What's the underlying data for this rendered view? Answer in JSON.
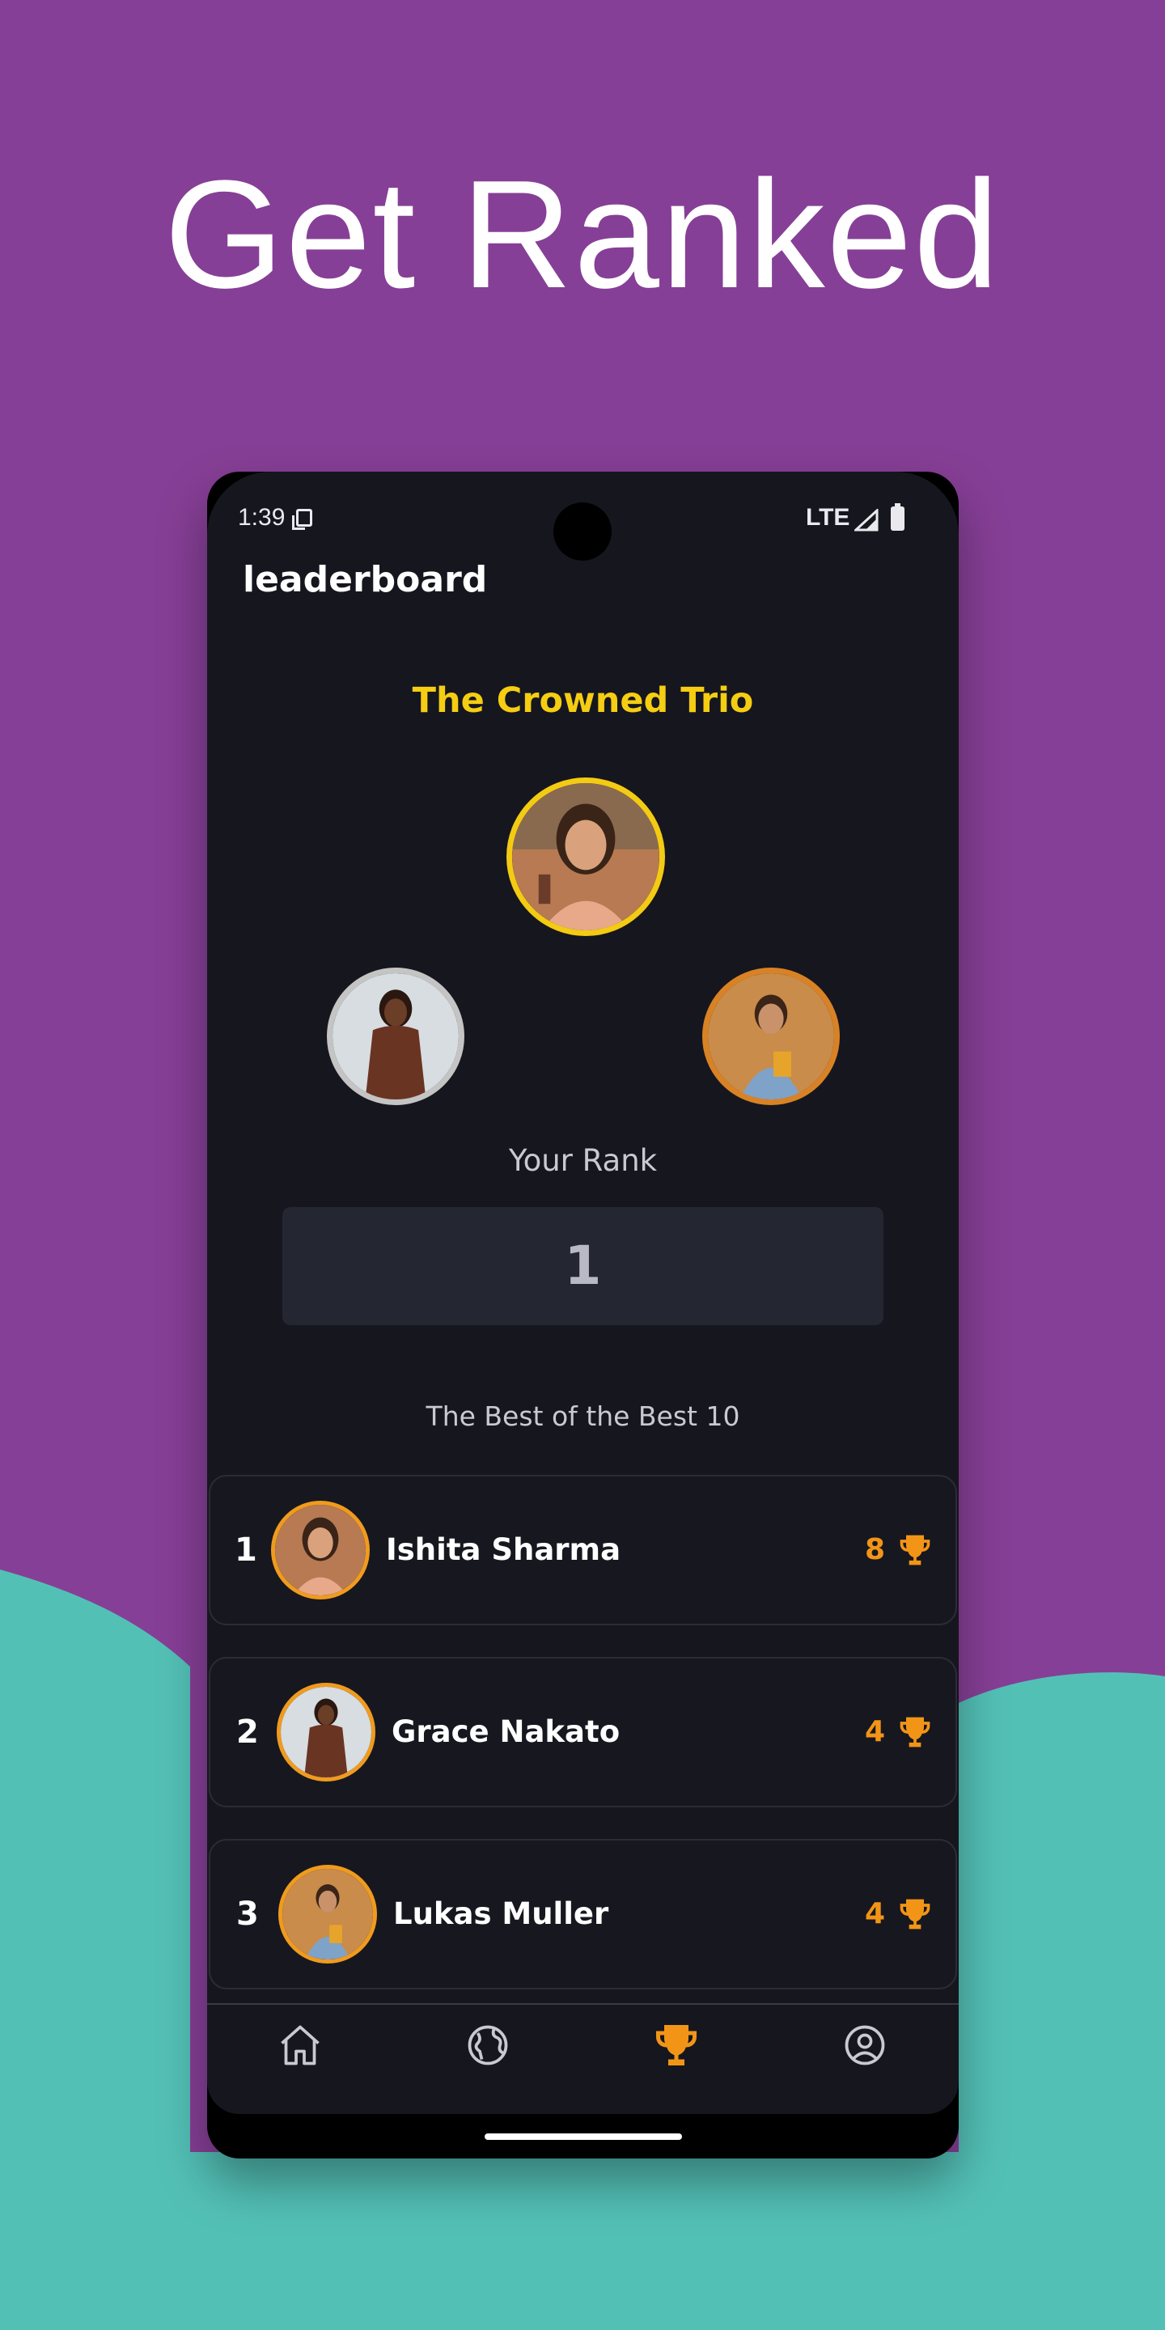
{
  "headline": "Get Ranked",
  "colors": {
    "background": "#863f96",
    "wave": "#53c0b6",
    "gold": "#f5cd12",
    "silver": "#c4c4c4",
    "bronze": "#d98225",
    "accent": "#f29516",
    "screen": "#16161f"
  },
  "status_bar": {
    "time": "1:39",
    "network": "LTE",
    "icons": [
      "sim-icon",
      "signal-icon",
      "battery-icon"
    ]
  },
  "app": {
    "title": "leaderboard"
  },
  "podium": {
    "title": "The Crowned Trio",
    "first": {
      "name": "Ishita Sharma",
      "avatar": "avatar-ishita"
    },
    "second": {
      "name": "Grace Nakato",
      "avatar": "avatar-grace"
    },
    "third": {
      "name": "Lukas Muller",
      "avatar": "avatar-lukas"
    }
  },
  "your_rank": {
    "label": "Your Rank",
    "value": "1"
  },
  "top_list": {
    "title": "The Best of the Best 10",
    "rows": [
      {
        "rank": "1",
        "name": "Ishita Sharma",
        "score": "8",
        "icon": "trophy-icon"
      },
      {
        "rank": "2",
        "name": "Grace Nakato",
        "score": "4",
        "icon": "trophy-icon"
      },
      {
        "rank": "3",
        "name": "Lukas Muller",
        "score": "4",
        "icon": "trophy-icon"
      }
    ]
  },
  "nav": {
    "items": [
      {
        "icon": "home-icon",
        "active": false
      },
      {
        "icon": "globe-icon",
        "active": false
      },
      {
        "icon": "trophy-icon",
        "active": true
      },
      {
        "icon": "profile-icon",
        "active": false
      }
    ]
  }
}
